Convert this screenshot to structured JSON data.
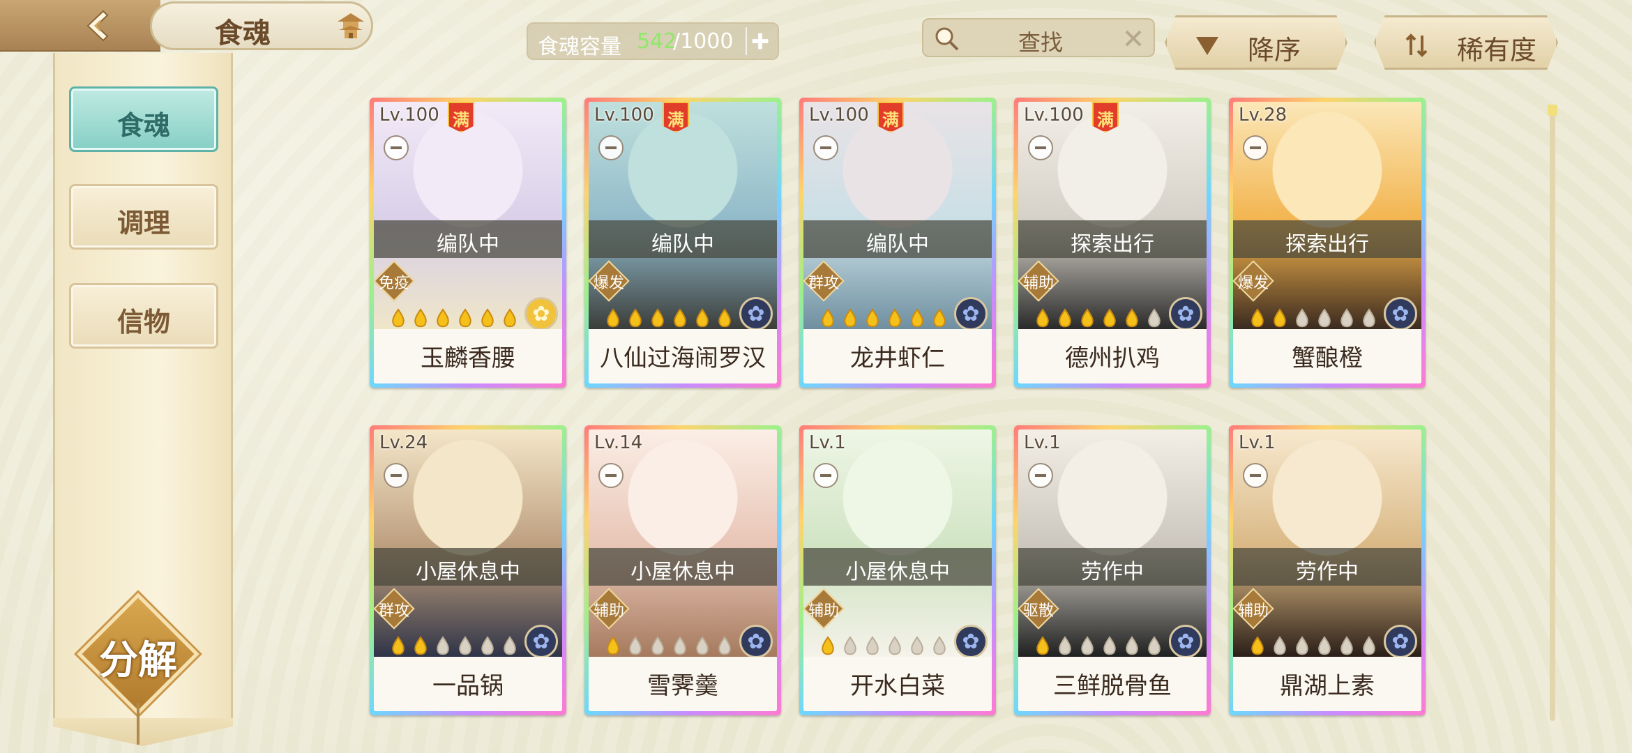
{
  "header": {
    "title": "食魂",
    "capacity_label": "食魂容量",
    "capacity_used": "542",
    "capacity_total": "/1000",
    "search_placeholder": "查找",
    "sort_order_label": "降序",
    "sort_key_label": "稀有度"
  },
  "sidebar": {
    "tabs": [
      {
        "label": "食魂",
        "active": true
      },
      {
        "label": "调理",
        "active": false
      },
      {
        "label": "信物",
        "active": false
      }
    ],
    "decompose_label": "分解"
  },
  "cards": [
    {
      "level": "Lv.100",
      "max": true,
      "max_label": "满",
      "status": "编队中",
      "role": "免疫",
      "stars": 6,
      "element": "gold",
      "name": "玉麟香腰",
      "palette": [
        "#f2eaf7",
        "#d8cfe8",
        "#efe6c8"
      ]
    },
    {
      "level": "Lv.100",
      "max": true,
      "max_label": "满",
      "status": "编队中",
      "role": "爆发",
      "stars": 6,
      "element": "blue",
      "name": "八仙过海闹罗汉",
      "palette": [
        "#bfe0dd",
        "#8fb8c8",
        "#3b3d3a"
      ]
    },
    {
      "level": "Lv.100",
      "max": true,
      "max_label": "满",
      "status": "编队中",
      "role": "群攻",
      "stars": 6,
      "element": "blue",
      "name": "龙井虾仁",
      "palette": [
        "#e9e3e6",
        "#c9dfe6",
        "#6f8fa0"
      ]
    },
    {
      "level": "Lv.100",
      "max": true,
      "max_label": "满",
      "status": "探索出行",
      "role": "辅助",
      "stars": 5,
      "element": "blue",
      "name": "德州扒鸡",
      "palette": [
        "#f2efe8",
        "#d4cfc6",
        "#2a2a2a"
      ]
    },
    {
      "level": "Lv.28",
      "max": false,
      "max_label": "",
      "status": "探索出行",
      "role": "爆发",
      "stars": 2,
      "element": "blue",
      "name": "蟹酿橙",
      "palette": [
        "#fbe7b8",
        "#f2b24a",
        "#3a2a20"
      ]
    },
    {
      "level": "Lv.24",
      "max": false,
      "max_label": "",
      "status": "小屋休息中",
      "role": "群攻",
      "stars": 2,
      "element": "blue",
      "name": "一品锅",
      "palette": [
        "#f4e6c8",
        "#b99a7a",
        "#2f3448"
      ]
    },
    {
      "level": "Lv.14",
      "max": false,
      "max_label": "",
      "status": "小屋休息中",
      "role": "辅助",
      "stars": 1,
      "element": "blue",
      "name": "雪霁羹",
      "palette": [
        "#fbeee6",
        "#e7c2b2",
        "#a57a5e"
      ]
    },
    {
      "level": "Lv.1",
      "max": false,
      "max_label": "",
      "status": "小屋休息中",
      "role": "辅助",
      "stars": 1,
      "element": "blue",
      "name": "开水白菜",
      "palette": [
        "#eef6e6",
        "#cfe3c2",
        "#f5f2ea"
      ]
    },
    {
      "level": "Lv.1",
      "max": false,
      "max_label": "",
      "status": "劳作中",
      "role": "驱散",
      "stars": 1,
      "element": "blue",
      "name": "三鲜脱骨鱼",
      "palette": [
        "#f3efe6",
        "#c9c4bb",
        "#1f2020"
      ]
    },
    {
      "level": "Lv.1",
      "max": false,
      "max_label": "",
      "status": "劳作中",
      "role": "辅助",
      "stars": 1,
      "element": "blue",
      "name": "鼎湖上素",
      "palette": [
        "#f7e9cf",
        "#d8b580",
        "#2a1e18"
      ]
    }
  ],
  "colors": {
    "accent_teal": "#86cfc5",
    "capacity_used": "#8ee86a",
    "star_lit": "#f5c01a",
    "star_dim": "#d9d2c4"
  }
}
